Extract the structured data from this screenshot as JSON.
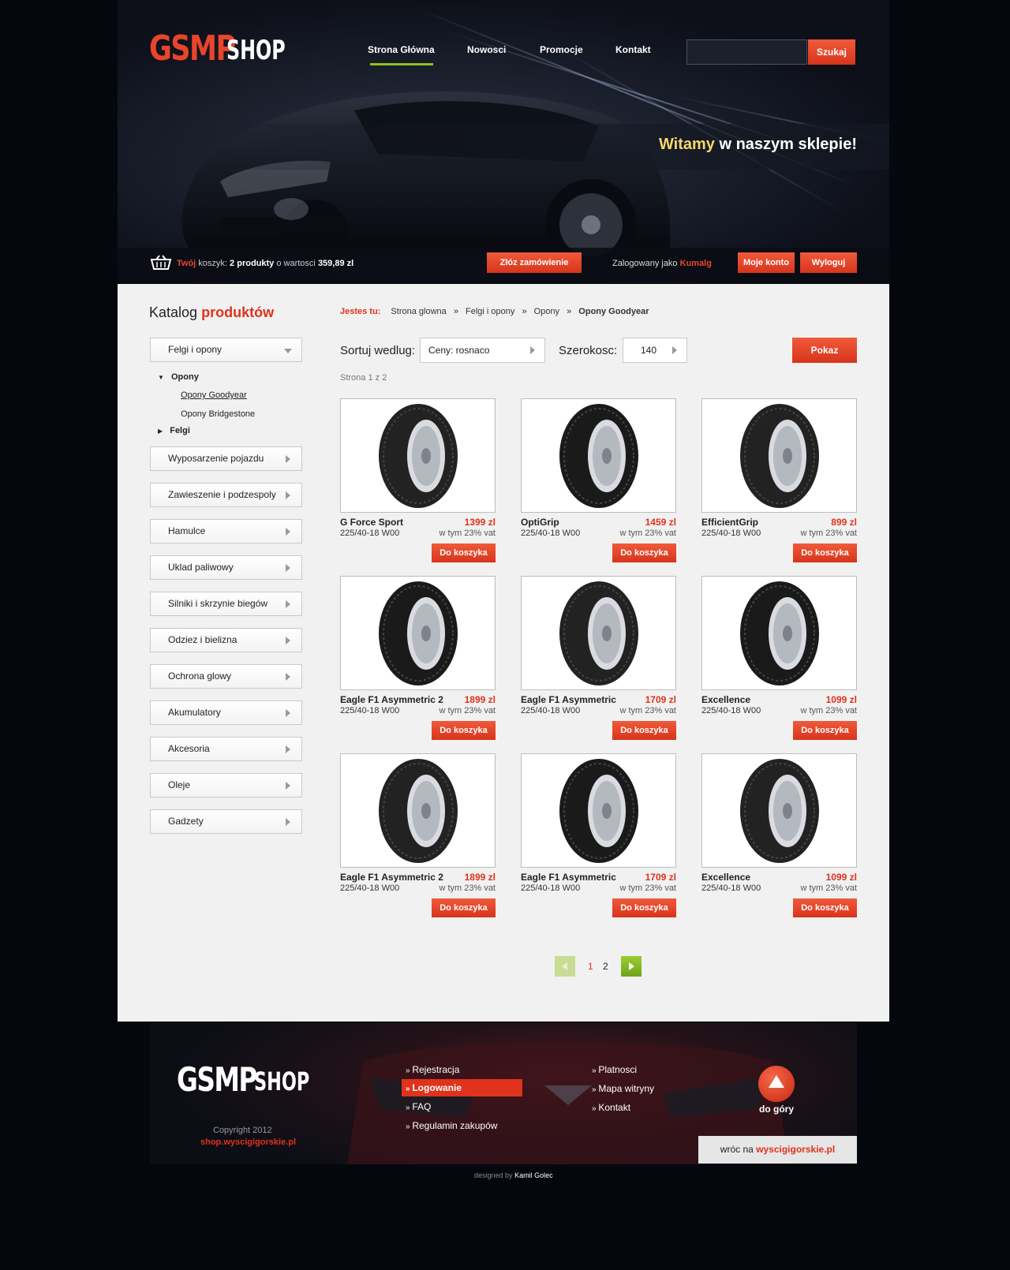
{
  "logo": {
    "gsmp": "GSMP",
    "shop": "SHOP"
  },
  "nav": {
    "items": [
      "Strona Główna",
      "Nowosci",
      "Promocje",
      "Kontakt"
    ]
  },
  "search": {
    "placeholder": "",
    "button": "Szukaj"
  },
  "welcome": {
    "highlight": "Witamy",
    "rest": "w naszym sklepie!"
  },
  "cart": {
    "twoj": "Twój",
    "label": "koszyk:",
    "count": "2 produkty",
    "value_label": "o wartosci",
    "value": "359,89 zl",
    "order_button": "Złóz zamówienie"
  },
  "user": {
    "logged_as": "Zalogowany jako",
    "name": "Kumalg",
    "account_button": "Moje konto",
    "logout_button": "Wyloguj"
  },
  "catalog": {
    "title_a": "Katalog",
    "title_b": "produktów"
  },
  "sidebar": {
    "top": "Felgi i opony",
    "tree": {
      "opony": "Opony",
      "goodyear": "Opony Goodyear",
      "bridgestone": "Opony Bridgestone",
      "felgi": "Felgi"
    },
    "items": [
      "Wyposarzenie pojazdu",
      "Zawieszenie i podzespoly",
      "Hamulce",
      "Uklad paliwowy",
      "Silniki i skrzynie biegów",
      "Odziez i bielizna",
      "Ochrona glowy",
      "Akumulatory",
      "Akcesoria",
      "Oleje",
      "Gadzety"
    ]
  },
  "breadcrumb": {
    "label": "Jestes tu:",
    "items": [
      "Strona glowna",
      "Felgi i opony",
      "Opony"
    ],
    "current": "Opony Goodyear",
    "sep": "»"
  },
  "filters": {
    "sort_label": "Sortuj wedlug:",
    "sort_value": "Ceny: rosnaco",
    "width_label": "Szerokosc:",
    "width_value": "140",
    "show_button": "Pokaz"
  },
  "page_info": "Strona 1 z 2",
  "products": [
    {
      "name": "G Force Sport",
      "size": "225/40-18 W00",
      "price": "1399 zl",
      "vat": "w tym 23% vat",
      "button": "Do koszyka"
    },
    {
      "name": "OptiGrip",
      "size": "225/40-18 W00",
      "price": "1459 zl",
      "vat": "w tym 23% vat",
      "button": "Do koszyka"
    },
    {
      "name": "EfficientGrip",
      "size": "225/40-18 W00",
      "price": "899 zl",
      "vat": "w tym 23% vat",
      "button": "Do koszyka"
    },
    {
      "name": "Eagle F1 Asymmetric 2",
      "size": "225/40-18 W00",
      "price": "1899 zl",
      "vat": "w tym 23% vat",
      "button": "Do koszyka"
    },
    {
      "name": "Eagle F1 Asymmetric",
      "size": "225/40-18 W00",
      "price": "1709 zl",
      "vat": "w tym 23% vat",
      "button": "Do koszyka"
    },
    {
      "name": "Excellence",
      "size": "225/40-18 W00",
      "price": "1099 zl",
      "vat": "w tym 23% vat",
      "button": "Do koszyka"
    },
    {
      "name": "Eagle F1 Asymmetric 2",
      "size": "225/40-18 W00",
      "price": "1899 zl",
      "vat": "w tym 23% vat",
      "button": "Do koszyka"
    },
    {
      "name": "Eagle F1 Asymmetric",
      "size": "225/40-18 W00",
      "price": "1709 zl",
      "vat": "w tym 23% vat",
      "button": "Do koszyka"
    },
    {
      "name": "Excellence",
      "size": "225/40-18 W00",
      "price": "1099 zl",
      "vat": "w tym 23% vat",
      "button": "Do koszyka"
    }
  ],
  "pagination": {
    "pages": [
      "1",
      "2"
    ],
    "current": "1"
  },
  "footer": {
    "copyright": "Copyright 2012",
    "site": "shop.wyscigigorskie.pl",
    "col1": [
      "Rejestracja",
      "Logowanie",
      "FAQ",
      "Regulamin zakupów"
    ],
    "col2": [
      "Platnosci",
      "Mapa witryny",
      "Kontakt"
    ],
    "top_label": "do góry",
    "back_label": "wróc na",
    "back_site": "wyscigigorskie.pl",
    "designed_by": "designed by",
    "designer": "Kamil Golec"
  },
  "colors": {
    "accent": "#e0321c",
    "nav_underline": "#8fc31f",
    "welcome_highlight": "#f4d96a",
    "page_green": "#8fc31f"
  }
}
